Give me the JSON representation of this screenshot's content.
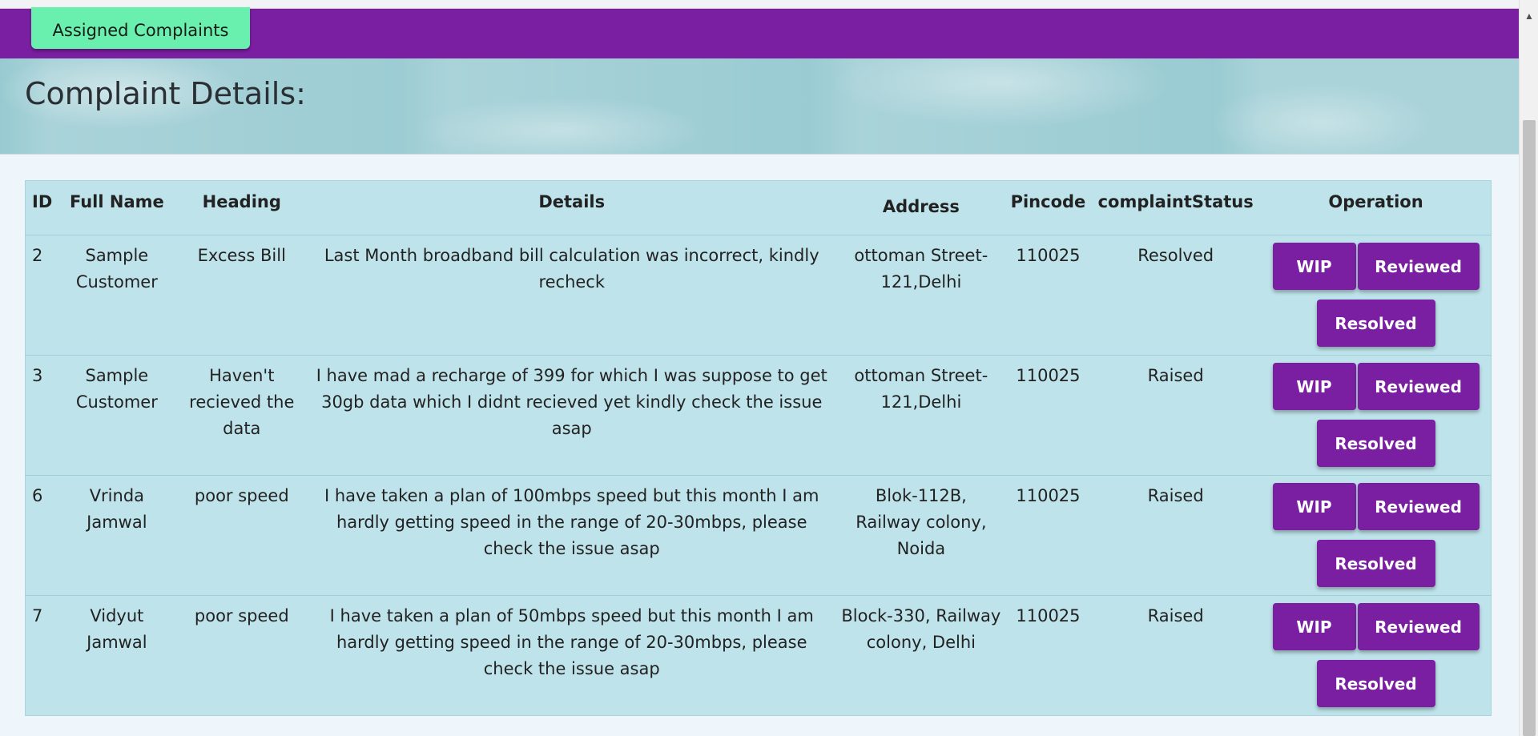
{
  "navbar": {
    "assigned_complaints_label": "Assigned Complaints"
  },
  "page": {
    "title": "Complaint Details:"
  },
  "table": {
    "headers": {
      "id": "ID",
      "full_name": "Full Name",
      "heading": "Heading",
      "details": "Details",
      "address": "Address",
      "pincode": "Pincode",
      "status": "complaintStatus",
      "operation": "Operation"
    },
    "rows": [
      {
        "id": "2",
        "full_name": "Sample Customer",
        "heading": "Excess Bill",
        "details": "Last Month broadband bill calculation was incorrect, kindly recheck",
        "address": "ottoman Street-121,Delhi",
        "pincode": "110025",
        "status": "Resolved"
      },
      {
        "id": "3",
        "full_name": "Sample Customer",
        "heading": "Haven't recieved the data",
        "details": "I have mad a recharge of 399 for which I was suppose to get 30gb data which I didnt recieved yet kindly check the issue asap",
        "address": "ottoman Street-121,Delhi",
        "pincode": "110025",
        "status": "Raised"
      },
      {
        "id": "6",
        "full_name": "Vrinda Jamwal",
        "heading": "poor speed",
        "details": "I have taken a plan of 100mbps speed but this month I am hardly getting speed in the range of 20-30mbps, please check the issue asap",
        "address": "Blok-112B, Railway colony, Noida",
        "pincode": "110025",
        "status": "Raised"
      },
      {
        "id": "7",
        "full_name": "Vidyut Jamwal",
        "heading": "poor speed",
        "details": "I have taken a plan of 50mbps speed but this month I am hardly getting speed in the range of 20-30mbps, please check the issue asap",
        "address": "Block-330, Railway colony, Delhi",
        "pincode": "110025",
        "status": "Raised"
      }
    ]
  },
  "operations": {
    "wip_label": "WIP",
    "reviewed_label": "Reviewed",
    "resolved_label": "Resolved"
  },
  "colors": {
    "navbar": "#7b1fa2",
    "nav_button": "#69f0ae",
    "table_bg": "#bee3ea",
    "op_button": "#7b1fa2",
    "page_bg": "#eef5fb"
  },
  "icons": {
    "scroll_up": "up-arrow-icon"
  }
}
